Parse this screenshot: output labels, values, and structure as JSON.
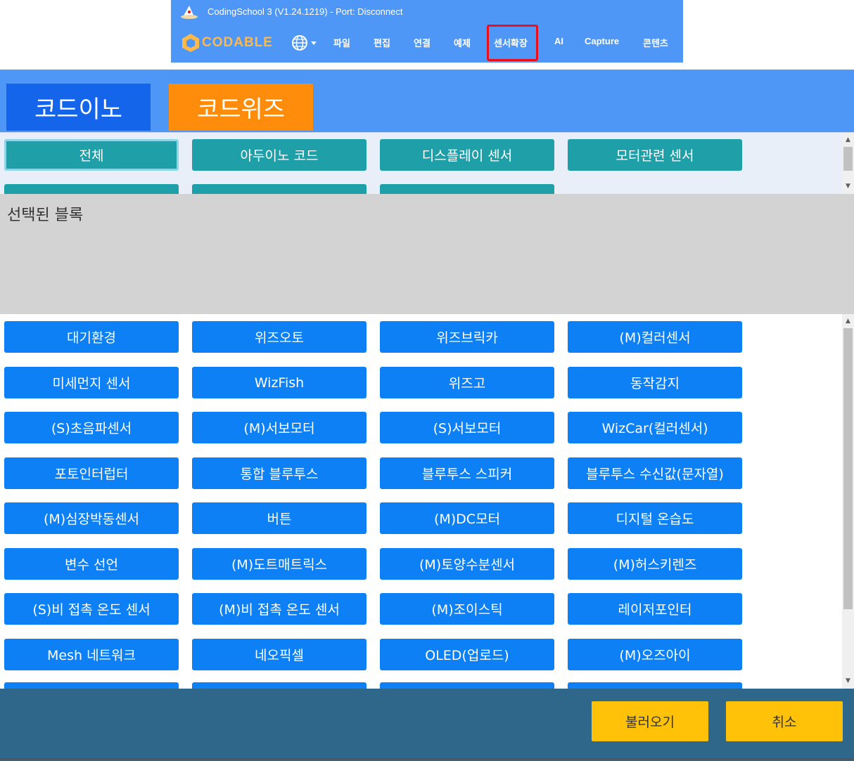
{
  "window": {
    "title": "CodingSchool 3 (V1.24.1219) - Port: Disconnect",
    "logo": "CODABLE",
    "globe_icon": "globe-icon",
    "menu": [
      "파일",
      "편집",
      "연결",
      "예제",
      "센서확장",
      "AI",
      "Capture",
      "콘텐츠"
    ],
    "highlighted_menu": "센서확장"
  },
  "tabs": [
    {
      "label": "코드이노",
      "color": "#1565ea"
    },
    {
      "label": "코드위즈",
      "color": "#ff8c0a",
      "active": true
    }
  ],
  "categories": [
    "전체",
    "아두이노 코드",
    "디스플레이 센서",
    "모터관련 센서"
  ],
  "active_category": "전체",
  "selected_blocks_label": "선택된 블록",
  "blocks": [
    "대기환경",
    "위즈오토",
    "위즈브릭카",
    "(M)컬러센서",
    "미세먼지 센서",
    "WizFish",
    "위즈고",
    "동작감지",
    "(S)초음파센서",
    "(M)서보모터",
    "(S)서보모터",
    "WizCar(컬러센서)",
    "포토인터럽터",
    "통합 블루투스",
    "블루투스 스피커",
    "블루투스 수신값(문자열)",
    "(M)심장박동센서",
    "버튼",
    "(M)DC모터",
    "디지털 온습도",
    "변수 선언",
    "(M)도트매트릭스",
    "(M)토양수분센서",
    "(M)허스키렌즈",
    "(S)비 접촉 온도 센서",
    "(M)비 접촉 온도 센서",
    "(M)조이스틱",
    "레이저포인터",
    "Mesh 네트워크",
    "네오픽셀",
    "OLED(업로드)",
    "(M)오즈아이"
  ],
  "highlighted_block": "(M)오즈아이",
  "footer": {
    "load_label": "불러오기",
    "cancel_label": "취소"
  },
  "colors": {
    "header_blue": "#4f97f7",
    "category_teal": "#1fa0a8",
    "block_blue": "#0d80f5",
    "footer_bg": "#2e6789",
    "button_yellow": "#ffc209",
    "highlight_red": "#e8101b"
  }
}
